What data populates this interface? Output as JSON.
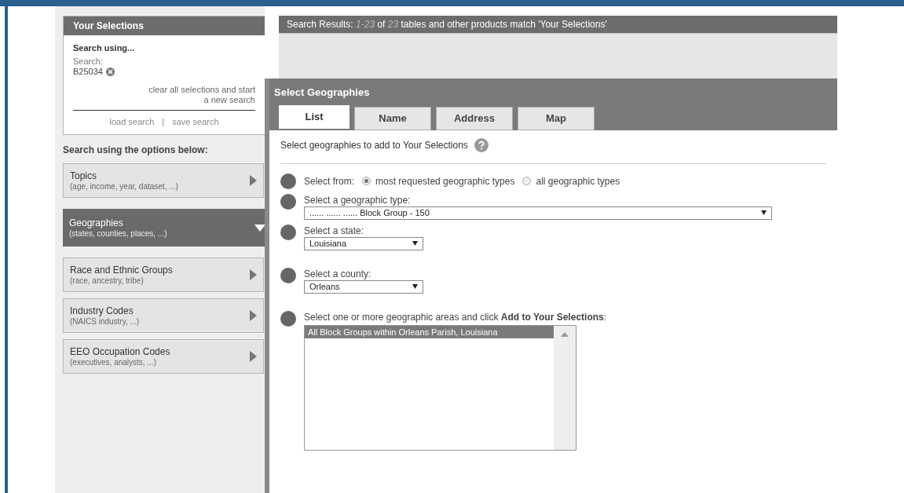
{
  "selections": {
    "title": "Your Selections",
    "heading": "Search using...",
    "search_label": "Search:",
    "search_value": "B25034",
    "clear_link": "clear all selections and start a new search",
    "load_link": "load search",
    "separator": "|",
    "save_link": "save search"
  },
  "options": {
    "heading": "Search using the options below:",
    "items": [
      {
        "title": "Topics",
        "subtitle": "(age, income, year, dataset, ...)",
        "expanded": false
      },
      {
        "title": "Geographies",
        "subtitle": "(states, counties, places, ...)",
        "expanded": true
      },
      {
        "title": "Race and Ethnic Groups",
        "subtitle": "(race, ancestry, tribe)",
        "expanded": false
      },
      {
        "title": "Industry Codes",
        "subtitle": "(NAICS industry, ...)",
        "expanded": false
      },
      {
        "title": "EEO Occupation Codes",
        "subtitle": "(executives, analysts, ...)",
        "expanded": false
      }
    ]
  },
  "results": {
    "header": "Search Results:  *1-23* of *23* tables and other products match 'Your Selections'"
  },
  "dialog": {
    "title": "Select Geographies",
    "tabs": [
      {
        "label": "List",
        "selected": true
      },
      {
        "label": "Name",
        "selected": false
      },
      {
        "label": "Address",
        "selected": false
      },
      {
        "label": "Map",
        "selected": false
      }
    ],
    "intro": "Select geographies to add to Your Selections",
    "steps": [
      {
        "kind": "radio",
        "label": "Select from:",
        "options": [
          {
            "label": "most requested geographic types",
            "selected": true
          },
          {
            "label": "all geographic types",
            "selected": false
          }
        ]
      },
      {
        "kind": "select",
        "label": "Select a geographic type:",
        "value": "...... ...... ...... Block Group - 150",
        "wide": true
      },
      {
        "kind": "select",
        "label": "Select a state:",
        "value": "Louisiana",
        "wide": false
      },
      {
        "kind": "select",
        "label": "Select a county:",
        "value": "Orleans",
        "wide": false
      },
      {
        "kind": "list",
        "label": "Select one or more geographic areas and click **Add to Your Selections**:",
        "items": [
          {
            "label": "All Block Groups within Orleans Parish, Louisiana",
            "selected": true
          }
        ]
      }
    ]
  }
}
